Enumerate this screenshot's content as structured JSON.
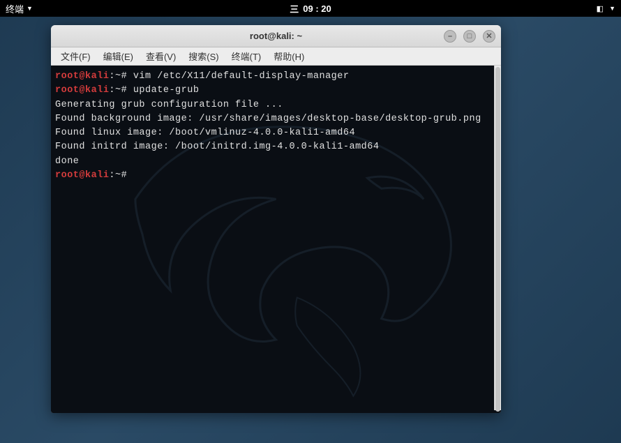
{
  "topbar": {
    "app_indicator": "终端",
    "clock_prefix": "三",
    "clock_time": "09 : 20"
  },
  "window": {
    "title": "root@kali: ~"
  },
  "menubar": {
    "file": "文件(F)",
    "edit": "编辑(E)",
    "view": "查看(V)",
    "search": "搜索(S)",
    "terminal": "终端(T)",
    "help": "帮助(H)"
  },
  "terminal": {
    "lines": [
      {
        "type": "prompt",
        "user": "root@",
        "host": "kali",
        "path": ":~#",
        "cmd": " vim /etc/X11/default-display-manager"
      },
      {
        "type": "prompt",
        "user": "root@",
        "host": "kali",
        "path": ":~#",
        "cmd": " update-grub"
      },
      {
        "type": "out",
        "text": "Generating grub configuration file ..."
      },
      {
        "type": "out",
        "text": "Found background image: /usr/share/images/desktop-base/desktop-grub.png"
      },
      {
        "type": "out",
        "text": "Found linux image: /boot/vmlinuz-4.0.0-kali1-amd64"
      },
      {
        "type": "out",
        "text": "Found initrd image: /boot/initrd.img-4.0.0-kali1-amd64"
      },
      {
        "type": "out",
        "text": "done"
      },
      {
        "type": "prompt",
        "user": "root@",
        "host": "kali",
        "path": ":~#",
        "cmd": " "
      }
    ]
  },
  "icons": {
    "minimize": "–",
    "maximize": "□",
    "close": "✕"
  }
}
